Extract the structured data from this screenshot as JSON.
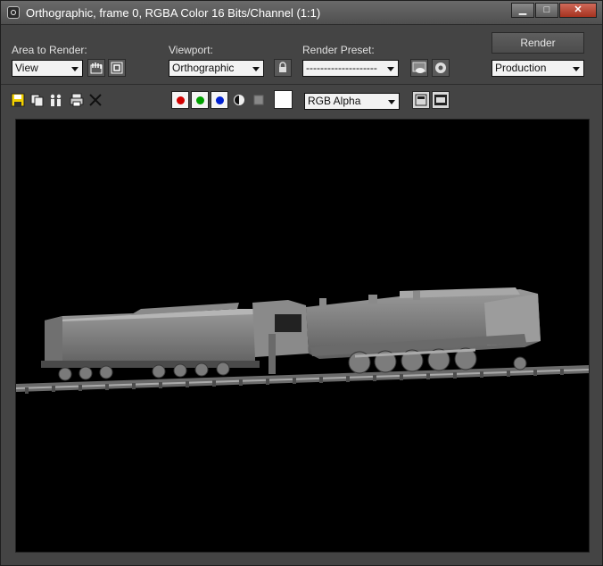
{
  "window": {
    "title": "Orthographic, frame 0, RGBA Color 16 Bits/Channel (1:1)",
    "controls": {
      "minimize": "▁",
      "maximize": "□",
      "close": "✕"
    }
  },
  "row1": {
    "area_label": "Area to Render:",
    "area_value": "View",
    "viewport_label": "Viewport:",
    "viewport_value": "Orthographic",
    "preset_label": "Render Preset:",
    "preset_value": "--------------------",
    "render_button": "Render",
    "production_value": "Production"
  },
  "row2": {
    "channel_value": "RGB Alpha"
  },
  "colors": {
    "red": "#d10000",
    "green": "#00a000",
    "blue": "#0020d0",
    "swatch": "#ffffff"
  },
  "icons": [
    "save-icon",
    "copy-icon",
    "clone-icon",
    "print-icon",
    "clear-icon",
    "mono-icon",
    "alpha-icon",
    "lock-icon",
    "edit-region-icon",
    "auto-region-icon",
    "teapot-icon",
    "environment-icon",
    "display-toggle-icon",
    "display-alpha-icon"
  ]
}
